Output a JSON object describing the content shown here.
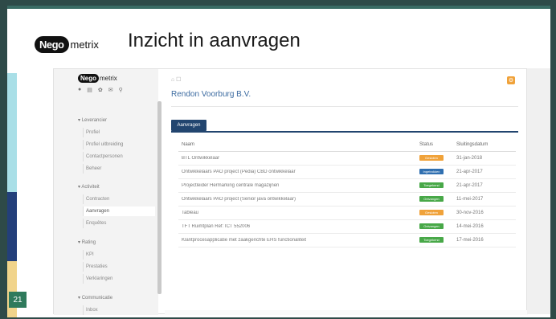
{
  "slide": {
    "title": "Inzicht in aanvragen",
    "page_number": "21",
    "brand": {
      "part1": "Nego",
      "part2": "metrix"
    }
  },
  "app": {
    "logo": {
      "part1": "Nego",
      "part2": "metrix"
    },
    "header_icons": [
      "home-icon",
      "document-icon",
      "gear-icon",
      "mail-icon",
      "search-icon"
    ],
    "breadcrumb": "⌂  ☐",
    "company": "Rendon Voorburg B.V.",
    "settings_icon": "⚙",
    "tab_label": "Aanvragen",
    "sidebar": {
      "groups": [
        {
          "label": "Leverancier",
          "items": [
            "Profiel",
            "Profiel uitbreiding",
            "Contactpersonen",
            "Beheer"
          ]
        },
        {
          "label": "Activiteit",
          "items": [
            "Contracten",
            "Aanvragen",
            "Enquêtes"
          ]
        },
        {
          "label": "Rating",
          "items": [
            "KPI",
            "Prestaties",
            "Verklaringen"
          ]
        },
        {
          "label": "Communicatie",
          "items": [
            "Inbox"
          ]
        }
      ],
      "active_item": "Aanvragen"
    },
    "table": {
      "headers": [
        "Naam",
        "Status",
        "Sluitingsdatum"
      ],
      "rows": [
        {
          "name": "BTL Ontwikkelaar",
          "status": "Gesloten",
          "status_color": "#f0a23a",
          "date": "31-jan-2018"
        },
        {
          "name": "Ontwikkelaars PAO project (Pedia) CBD ontwikkelaar",
          "status": "Ingetrokken",
          "status_color": "#2f6fb0",
          "date": "21-apr-2017"
        },
        {
          "name": "Projectleider Hermarking centrale magazijnen",
          "status": "Toegekend",
          "status_color": "#48a848",
          "date": "21-apr-2017"
        },
        {
          "name": "Ontwikkelaars PAO project (Senior java ontwikkelaar)",
          "status": "Ontvangen",
          "status_color": "#48a848",
          "date": "11-mei-2017"
        },
        {
          "name": "Tableau",
          "status": "Gesloten",
          "status_color": "#f0a23a",
          "date": "30-nov-2016"
        },
        {
          "name": "TFT Ruimtplan Ref: ICT 552006",
          "status": "Ontvangen",
          "status_color": "#48a848",
          "date": "14-mei-2016"
        },
        {
          "name": "Klantprocesapplicatie met zaakgerichte EHS functionaliteit",
          "status": "Toegekend",
          "status_color": "#48a848",
          "date": "17-mei-2016"
        }
      ]
    }
  }
}
